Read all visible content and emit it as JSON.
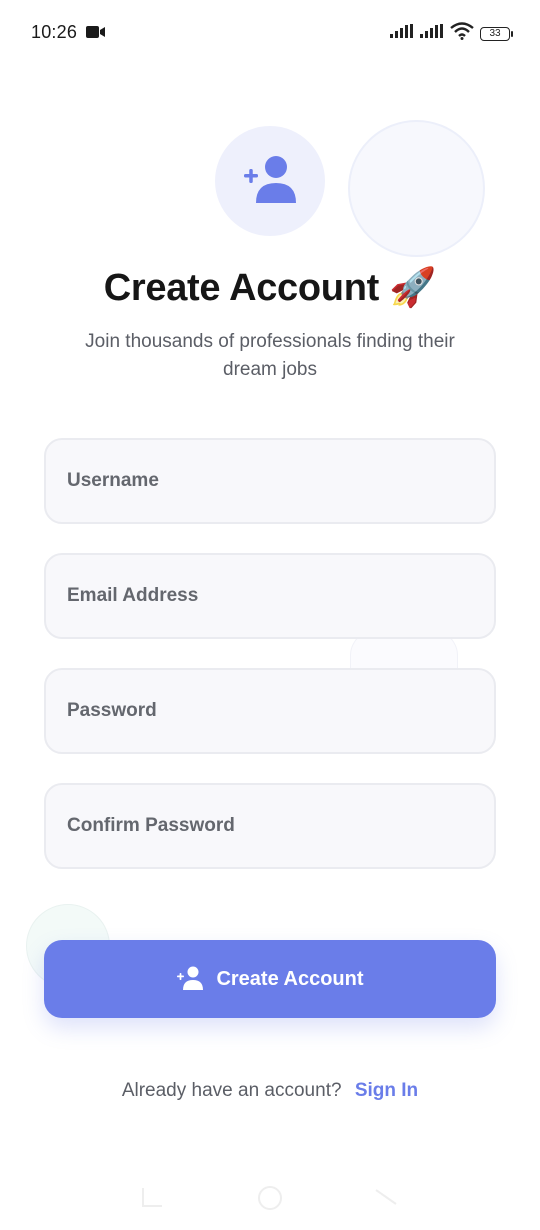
{
  "status_bar": {
    "time": "10:26",
    "battery": "33"
  },
  "header": {
    "title": "Create Account",
    "title_emoji": "🚀",
    "subtitle": "Join thousands of professionals finding their dream jobs"
  },
  "form": {
    "username_placeholder": "Username",
    "email_placeholder": "Email Address",
    "password_placeholder": "Password",
    "confirm_password_placeholder": "Confirm Password",
    "submit_label": "Create Account"
  },
  "footer": {
    "prompt": "Already have an account?",
    "link": "Sign In"
  },
  "colors": {
    "accent": "#6a7de9",
    "avatar_bg": "#eef0fc",
    "field_bg": "#f8f8fb"
  },
  "icons": [
    "video-camera-icon",
    "signal-icon",
    "wifi-icon",
    "battery-icon",
    "add-user-icon"
  ]
}
